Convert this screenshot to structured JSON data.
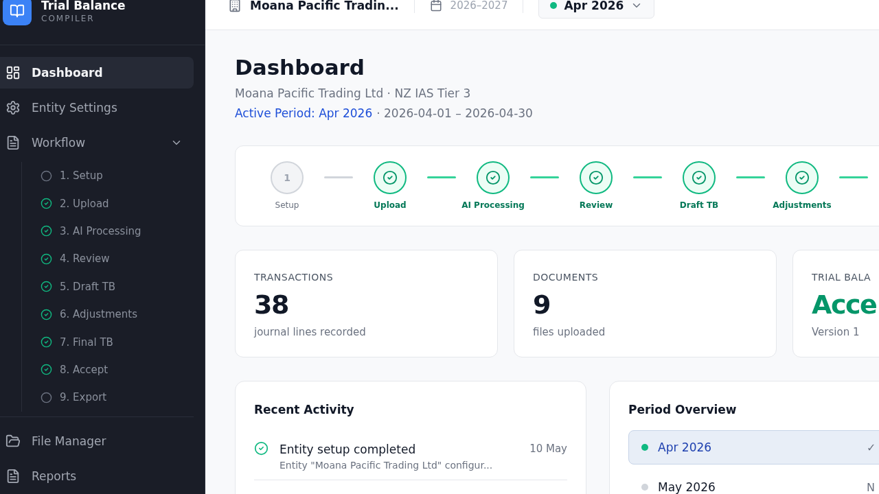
{
  "app": {
    "title": "Trial Balance",
    "subtitle": "COMPILER"
  },
  "sidebar": {
    "items": [
      {
        "label": "Dashboard",
        "selected": true
      },
      {
        "label": "Entity Settings",
        "selected": false
      },
      {
        "label": "Workflow",
        "selected": false,
        "expanded": true,
        "children": [
          {
            "label": "1. Setup",
            "done": false
          },
          {
            "label": "2. Upload",
            "done": true
          },
          {
            "label": "3. AI Processing",
            "done": true
          },
          {
            "label": "4. Review",
            "done": true
          },
          {
            "label": "5. Draft TB",
            "done": true
          },
          {
            "label": "6. Adjustments",
            "done": true
          },
          {
            "label": "7. Final TB",
            "done": true
          },
          {
            "label": "8. Accept",
            "done": true
          },
          {
            "label": "9. Export",
            "done": false
          }
        ]
      },
      {
        "label": "File Manager",
        "selected": false
      },
      {
        "label": "Reports",
        "selected": false
      }
    ]
  },
  "top_bar": {
    "entity": "Moana Pacific Tradin...",
    "year": "2026–2027",
    "period": "Apr 2026"
  },
  "page": {
    "title": "Dashboard",
    "subtitle": "Moana Pacific Trading Ltd · NZ IAS Tier 3",
    "active_period": "Active Period: Apr 2026",
    "dates": "· 2026-04-01 – 2026-04-30"
  },
  "stepper": [
    {
      "label": "Setup",
      "number": "1",
      "done": false
    },
    {
      "label": "Upload",
      "done": true
    },
    {
      "label": "AI Processing",
      "done": true
    },
    {
      "label": "Review",
      "done": true
    },
    {
      "label": "Draft TB",
      "done": true
    },
    {
      "label": "Adjustments",
      "done": true
    }
  ],
  "stats": [
    {
      "kind": "count",
      "label": "TRANSACTIONS",
      "value": "38",
      "note": "journal lines recorded"
    },
    {
      "kind": "count",
      "label": "DOCUMENTS",
      "value": "9",
      "note": "files uploaded"
    },
    {
      "kind": "status",
      "label": "TRIAL BALA",
      "value": "Acce",
      "note": "Version 1"
    }
  ],
  "recent_activity": {
    "title": "Recent Activity",
    "items": [
      {
        "title": "Entity setup completed",
        "detail": "Entity \"Moana Pacific Trading Ltd\" configur...",
        "date": "10 May",
        "done": true
      }
    ]
  },
  "period_overview": {
    "title": "Period Overview",
    "items": [
      {
        "label": "Apr 2026",
        "selected": true,
        "color": "#10b981",
        "status": "✓"
      },
      {
        "label": "May 2026",
        "selected": false,
        "color": "#d1d5db",
        "status": "N"
      }
    ]
  }
}
